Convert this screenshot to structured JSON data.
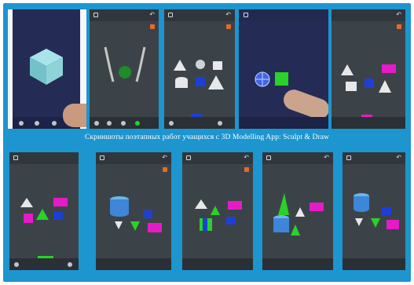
{
  "caption": "Скриншоты поэтапных работ учащихся с 3D Modelling App: Sculpt & Draw",
  "accent_color": "#1d95cf",
  "object_colors": {
    "magenta": "#e51bc8",
    "green": "#2ad12a",
    "blue": "#1e3fd6",
    "white": "#e6e8ea",
    "cyan": "#8ad0d6",
    "orange": "#e8692a"
  },
  "screenshots": [
    {
      "name": "cube-on-phone"
    },
    {
      "name": "hands-tool"
    },
    {
      "name": "primitive-set"
    },
    {
      "name": "hand-gesture"
    },
    {
      "name": "colored-set"
    },
    {
      "name": "bottom-1"
    },
    {
      "name": "bottom-2"
    },
    {
      "name": "bottom-3"
    },
    {
      "name": "bottom-4"
    },
    {
      "name": "bottom-5"
    }
  ],
  "icons": [
    "undo-icon",
    "settings-icon",
    "layers-icon",
    "sphere-icon",
    "cube-icon",
    "cone-icon",
    "cylinder-icon"
  ]
}
